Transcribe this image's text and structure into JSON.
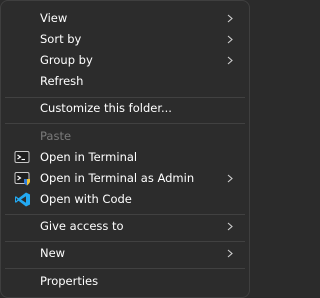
{
  "menu": {
    "view": {
      "label": "View",
      "icon": "",
      "submenu": true
    },
    "sort_by": {
      "label": "Sort by",
      "icon": "",
      "submenu": true
    },
    "group_by": {
      "label": "Group by",
      "icon": "",
      "submenu": true
    },
    "refresh": {
      "label": "Refresh",
      "icon": ""
    },
    "customize": {
      "label": "Customize this folder..."
    },
    "paste": {
      "label": "Paste",
      "disabled": true
    },
    "open_terminal": {
      "label": "Open in Terminal",
      "icon": "terminal-icon"
    },
    "open_terminal_admin": {
      "label": "Open in Terminal as Admin",
      "icon": "terminal-admin-icon",
      "submenu": true
    },
    "open_code": {
      "label": "Open with Code",
      "icon": "vscode-icon"
    },
    "give_access": {
      "label": "Give access to",
      "submenu": true
    },
    "new": {
      "label": "New",
      "submenu": true
    },
    "properties": {
      "label": "Properties"
    }
  },
  "colors": {
    "background": "#2c2c2c",
    "text": "#ffffff",
    "disabled_text": "#7a7a7a",
    "separator": "#414141",
    "vscode_blue": "#23a9f2"
  }
}
